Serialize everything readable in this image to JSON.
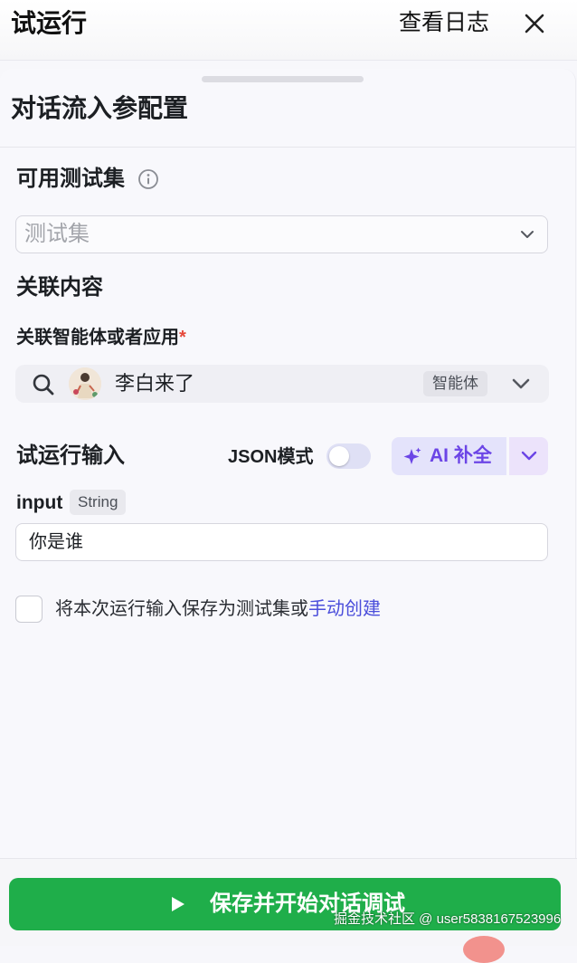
{
  "header": {
    "title": "试运行",
    "log_label": "查看日志",
    "close_icon": "close-icon"
  },
  "panel": {
    "title": "对话流入参配置"
  },
  "test_set": {
    "label": "可用测试集",
    "placeholder": "测试集"
  },
  "related": {
    "section_label": "关联内容",
    "field_label": "关联智能体或者应用",
    "required_mark": "*",
    "agent_name": "李白来了",
    "agent_tag": "智能体"
  },
  "trial_input": {
    "section_label": "试运行输入",
    "json_mode_label": "JSON模式",
    "json_mode_on": false,
    "ai_fill_label": "AI 补全",
    "param_name": "input",
    "param_type": "String",
    "param_value": "你是谁"
  },
  "save_option": {
    "text": "将本次运行输入保存为测试集或",
    "link": "手动创建",
    "checked": false
  },
  "footer": {
    "start_label": "保存并开始对话调试",
    "watermark": "掘金技术社区 @ user5838167523996"
  },
  "colors": {
    "primary_green": "#1fae4a",
    "ai_purple": "#6b45e6",
    "link_blue": "#4b4edb",
    "required_red": "#e5483a"
  }
}
